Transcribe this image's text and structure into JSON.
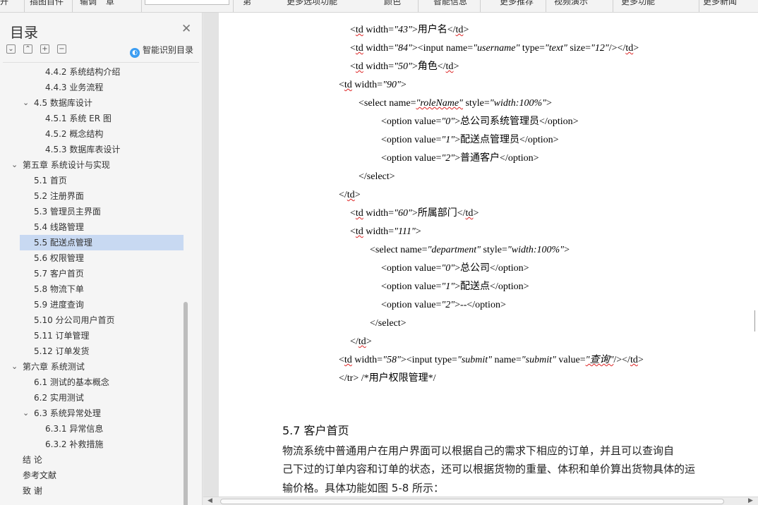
{
  "toolbar": {
    "items": [
      "开",
      "插图目件",
      "输调",
      "章",
      "第",
      "更多选项功能",
      "颜色",
      "智能信息",
      "更多推荐",
      "视频演示",
      "更多功能",
      "更多新闻"
    ]
  },
  "nav": {
    "title": "目录",
    "smart_label": "智能识别目录",
    "items": [
      {
        "label": "4.4.2 系统结构介绍",
        "level": 3,
        "expand": false,
        "selected": false
      },
      {
        "label": "4.4.3 业务流程",
        "level": 3,
        "expand": false,
        "selected": false
      },
      {
        "label": "4.5 数据库设计",
        "level": 2,
        "expand": true,
        "selected": false
      },
      {
        "label": "4.5.1 系统 ER 图",
        "level": 3,
        "expand": false,
        "selected": false
      },
      {
        "label": "4.5.2 概念结构",
        "level": 3,
        "expand": false,
        "selected": false
      },
      {
        "label": "4.5.3 数据库表设计",
        "level": 3,
        "expand": false,
        "selected": false
      },
      {
        "label": "第五章 系统设计与实现",
        "level": 1,
        "expand": true,
        "selected": false
      },
      {
        "label": "5.1 首页",
        "level": 2,
        "expand": false,
        "selected": false
      },
      {
        "label": "5.2 注册界面",
        "level": 2,
        "expand": false,
        "selected": false
      },
      {
        "label": "5.3 管理员主界面",
        "level": 2,
        "expand": false,
        "selected": false
      },
      {
        "label": "5.4 线路管理",
        "level": 2,
        "expand": false,
        "selected": false
      },
      {
        "label": "5.5 配送点管理",
        "level": 2,
        "expand": false,
        "selected": true
      },
      {
        "label": "5.6 权限管理",
        "level": 2,
        "expand": false,
        "selected": false
      },
      {
        "label": "5.7 客户首页",
        "level": 2,
        "expand": false,
        "selected": false
      },
      {
        "label": "5.8 物流下单",
        "level": 2,
        "expand": false,
        "selected": false
      },
      {
        "label": "5.9 进度查询",
        "level": 2,
        "expand": false,
        "selected": false
      },
      {
        "label": "5.10 分公司用户首页",
        "level": 2,
        "expand": false,
        "selected": false
      },
      {
        "label": "5.11 订单管理",
        "level": 2,
        "expand": false,
        "selected": false
      },
      {
        "label": "5.12 订单发货",
        "level": 2,
        "expand": false,
        "selected": false
      },
      {
        "label": "第六章 系统测试",
        "level": 1,
        "expand": true,
        "selected": false
      },
      {
        "label": "6.1 测试的基本概念",
        "level": 2,
        "expand": false,
        "selected": false
      },
      {
        "label": "6.2 实用测试",
        "level": 2,
        "expand": false,
        "selected": false
      },
      {
        "label": "6.3 系统异常处理",
        "level": 2,
        "expand": true,
        "selected": false
      },
      {
        "label": "6.3.1 异常信息",
        "level": 3,
        "expand": false,
        "selected": false
      },
      {
        "label": "6.3.2 补救措施",
        "level": 3,
        "expand": false,
        "selected": false
      },
      {
        "label": "结 论",
        "level": 1,
        "expand": false,
        "selected": false
      },
      {
        "label": "参考文献",
        "level": 1,
        "expand": false,
        "selected": false
      },
      {
        "label": "致 谢",
        "level": 1,
        "expand": false,
        "selected": false
      }
    ]
  },
  "doc": {
    "code_lines": [
      {
        "indent": 1,
        "parts": [
          [
            "&lt;",
            ""
          ],
          [
            "td",
            "w"
          ],
          [
            " width=",
            ""
          ],
          [
            "\"43\"",
            "v"
          ],
          [
            ">用户名</",
            ""
          ],
          [
            "td",
            "w"
          ],
          [
            ">",
            ""
          ]
        ]
      },
      {
        "indent": 1,
        "parts": [
          [
            "<",
            ""
          ],
          [
            "td",
            "w"
          ],
          [
            " width=",
            ""
          ],
          [
            "\"84\"",
            "v"
          ],
          [
            "><input name=",
            ""
          ],
          [
            "\"username\"",
            "v"
          ],
          [
            " type=",
            ""
          ],
          [
            "\"text\"",
            "v"
          ],
          [
            " size=",
            ""
          ],
          [
            "\"12\"",
            "v"
          ],
          [
            "/></",
            ""
          ],
          [
            "td",
            "w"
          ],
          [
            ">",
            ""
          ]
        ]
      },
      {
        "indent": 1,
        "parts": [
          [
            "<",
            ""
          ],
          [
            "td",
            "w"
          ],
          [
            " width=",
            ""
          ],
          [
            "\"50\"",
            "v"
          ],
          [
            ">角色</",
            ""
          ],
          [
            "td",
            "w"
          ],
          [
            ">",
            ""
          ]
        ]
      },
      {
        "indent": 0,
        "parts": [
          [
            "<",
            ""
          ],
          [
            "td",
            "w"
          ],
          [
            " width=",
            ""
          ],
          [
            "\"90\"",
            "v"
          ],
          [
            ">",
            ""
          ]
        ]
      },
      {
        "indent": 2,
        "parts": [
          [
            "<select name=",
            ""
          ],
          [
            "\"roleName\"",
            "v w"
          ],
          [
            " style=",
            ""
          ],
          [
            "\"width:100%\"",
            "v"
          ],
          [
            ">",
            ""
          ]
        ]
      },
      {
        "indent": 4,
        "parts": [
          [
            "<option value=",
            ""
          ],
          [
            "\"0\"",
            "v"
          ],
          [
            ">总公司系统管理员</option>",
            ""
          ]
        ]
      },
      {
        "indent": 4,
        "parts": [
          [
            "<option value=",
            ""
          ],
          [
            "\"1\"",
            "v"
          ],
          [
            ">配送点管理员</option>",
            ""
          ]
        ]
      },
      {
        "indent": 4,
        "parts": [
          [
            "<option value=",
            ""
          ],
          [
            "\"2\"",
            "v"
          ],
          [
            ">普通客户</option>",
            ""
          ]
        ]
      },
      {
        "indent": 2,
        "parts": [
          [
            "</select>",
            ""
          ]
        ]
      },
      {
        "indent": 0,
        "parts": [
          [
            "</",
            ""
          ],
          [
            "td",
            "w"
          ],
          [
            ">",
            ""
          ]
        ]
      },
      {
        "indent": 1,
        "parts": [
          [
            "<",
            ""
          ],
          [
            "td",
            "w"
          ],
          [
            " width=",
            ""
          ],
          [
            "\"60\"",
            "v"
          ],
          [
            ">所属部门</",
            ""
          ],
          [
            "td",
            "w"
          ],
          [
            ">",
            ""
          ]
        ]
      },
      {
        "indent": 1,
        "parts": [
          [
            "<",
            ""
          ],
          [
            "td",
            "w"
          ],
          [
            " width=",
            ""
          ],
          [
            "\"111\"",
            "v"
          ],
          [
            ">",
            ""
          ]
        ]
      },
      {
        "indent": 3,
        "parts": [
          [
            "<select name=",
            ""
          ],
          [
            "\"department\"",
            "v"
          ],
          [
            " style=",
            ""
          ],
          [
            "\"width:100%\"",
            "v"
          ],
          [
            ">",
            ""
          ]
        ]
      },
      {
        "indent": 4,
        "parts": [
          [
            "<option value=",
            ""
          ],
          [
            "\"0\"",
            "v"
          ],
          [
            ">总公司</option>",
            ""
          ]
        ]
      },
      {
        "indent": 4,
        "parts": [
          [
            "<option value=",
            ""
          ],
          [
            "\"1\"",
            "v"
          ],
          [
            ">配送点</option>",
            ""
          ]
        ]
      },
      {
        "indent": 4,
        "parts": [
          [
            "<option value=",
            ""
          ],
          [
            "\"2\"",
            "v"
          ],
          [
            ">--</option>",
            ""
          ]
        ]
      },
      {
        "indent": 3,
        "parts": [
          [
            "</select>",
            ""
          ]
        ]
      },
      {
        "indent": 1,
        "parts": [
          [
            "</",
            ""
          ],
          [
            "td",
            "w"
          ],
          [
            ">",
            ""
          ]
        ]
      },
      {
        "indent": 0,
        "parts": [
          [
            "<",
            ""
          ],
          [
            "td",
            "w"
          ],
          [
            " width=",
            ""
          ],
          [
            "\"58\"",
            "v"
          ],
          [
            "><input type=",
            ""
          ],
          [
            "\"submit\"",
            "v"
          ],
          [
            " name=",
            ""
          ],
          [
            "\"submit\"",
            "v"
          ],
          [
            " value=",
            ""
          ],
          [
            "\"查询\"",
            "v w"
          ],
          [
            "/></",
            ""
          ],
          [
            "td",
            "w"
          ],
          [
            ">",
            ""
          ]
        ]
      },
      {
        "indent": 0,
        "parts": [
          [
            "</tr>   /*用户权限管理*/",
            ""
          ]
        ]
      }
    ],
    "heading": "5.7 客户首页",
    "paragraph": [
      "物流系统中普通用户在用户界面可以根据自己的需求下相应的订单，并且可以查询自",
      "己下过的订单内容和订单的状态，还可以根据货物的重量、体积和单价算出货物具体的运",
      "输价格。具体功能如图 5-8 所示："
    ]
  }
}
